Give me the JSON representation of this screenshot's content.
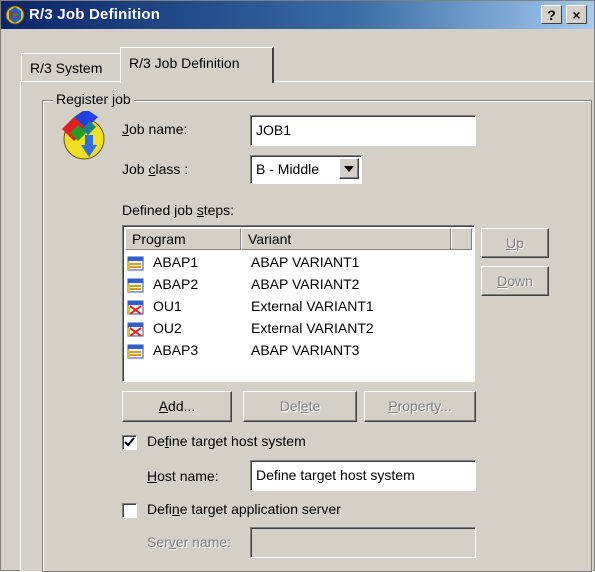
{
  "window": {
    "title": "R/3 Job Definition",
    "help_label": "?",
    "close_label": "×"
  },
  "tabs": [
    {
      "label": "R/3 System",
      "active": false
    },
    {
      "label": "R/3 Job Definition",
      "active": true
    }
  ],
  "group": {
    "title": "Register job"
  },
  "job_name": {
    "label": "Job name:",
    "mnemonic": "J",
    "rest": "ob name:",
    "value": "JOB1"
  },
  "job_class": {
    "label_pre": "Job ",
    "mnemonic": "c",
    "label_post": "lass :",
    "value": "B - Middle"
  },
  "steps": {
    "label_pre": "Defined job ",
    "mnemonic": "s",
    "label_post": "teps:",
    "columns": [
      "Program",
      "Variant"
    ],
    "rows": [
      {
        "program": "ABAP1",
        "variant": "ABAP VARIANT1",
        "icon": "abap-program-icon"
      },
      {
        "program": "ABAP2",
        "variant": "ABAP VARIANT2",
        "icon": "abap-program-icon"
      },
      {
        "program": "OU1",
        "variant": "External VARIANT1",
        "icon": "external-program-icon"
      },
      {
        "program": "OU2",
        "variant": "External VARIANT2",
        "icon": "external-program-icon"
      },
      {
        "program": "ABAP3",
        "variant": "ABAP VARIANT3",
        "icon": "abap-program-icon"
      }
    ]
  },
  "side_buttons": {
    "up_mnemonic": "U",
    "up_rest": "p",
    "down_mnemonic": "D",
    "down_rest": "own"
  },
  "actions": {
    "add_mnemonic": "A",
    "add_rest": "dd...",
    "delete_pre": "Del",
    "delete_mnemonic": "e",
    "delete_post": "te",
    "property_mnemonic": "P",
    "property_rest": "roperty..."
  },
  "target_host": {
    "checked": true,
    "label_pre": "De",
    "mnemonic": "f",
    "label_post": "ine target host system",
    "host_label_mnemonic": "H",
    "host_label_rest": "ost name:",
    "host_value": "Define target host system"
  },
  "target_app": {
    "checked": false,
    "label_pre": "Defi",
    "mnemonic": "n",
    "label_post": "e target application server",
    "server_label_pre": "Ser",
    "server_mnemonic": "v",
    "server_label_post": "er name:",
    "server_value": ""
  }
}
